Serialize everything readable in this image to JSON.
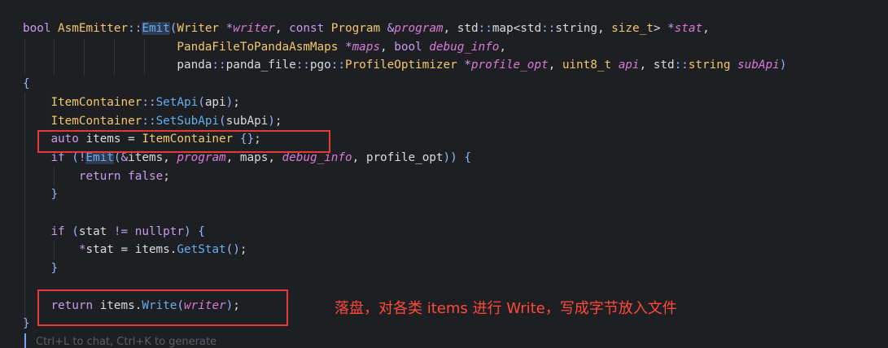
{
  "editor": {
    "lines": [
      [
        [
          "kw",
          "bool "
        ],
        [
          "type",
          "AsmEmitter"
        ],
        [
          "punc",
          "::"
        ],
        [
          "fn hl",
          "Emit"
        ],
        [
          "punc",
          "("
        ],
        [
          "type",
          "Writer "
        ],
        [
          "op",
          "*"
        ],
        [
          "param",
          "writer"
        ],
        [
          "plain",
          ", "
        ],
        [
          "kw",
          "const "
        ],
        [
          "type",
          "Program "
        ],
        [
          "op",
          "&"
        ],
        [
          "param",
          "program"
        ],
        [
          "plain",
          ", std"
        ],
        [
          "punc",
          "::"
        ],
        [
          "plain",
          "map<std"
        ],
        [
          "punc",
          "::"
        ],
        [
          "plain",
          "string, "
        ],
        [
          "type",
          "size_t"
        ],
        [
          "plain",
          "> "
        ],
        [
          "op",
          "*"
        ],
        [
          "param",
          "stat"
        ],
        [
          "plain",
          ","
        ]
      ],
      [
        [
          "plain",
          "                      "
        ],
        [
          "type",
          "PandaFileToPandaAsmMaps "
        ],
        [
          "op",
          "*"
        ],
        [
          "param",
          "maps"
        ],
        [
          "plain",
          ", "
        ],
        [
          "kw",
          "bool "
        ],
        [
          "param",
          "debug_info"
        ],
        [
          "plain",
          ","
        ]
      ],
      [
        [
          "plain",
          "                      panda"
        ],
        [
          "punc",
          "::"
        ],
        [
          "plain",
          "panda_file"
        ],
        [
          "punc",
          "::"
        ],
        [
          "plain",
          "pgo"
        ],
        [
          "punc",
          "::"
        ],
        [
          "type",
          "ProfileOptimizer "
        ],
        [
          "op",
          "*"
        ],
        [
          "param",
          "profile_opt"
        ],
        [
          "plain",
          ", "
        ],
        [
          "type",
          "uint8_t "
        ],
        [
          "param",
          "api"
        ],
        [
          "plain",
          ", std"
        ],
        [
          "punc",
          "::"
        ],
        [
          "type",
          "string "
        ],
        [
          "param",
          "subApi"
        ],
        [
          "punc",
          ")"
        ]
      ],
      [
        [
          "punc",
          "{"
        ]
      ],
      [
        [
          "plain",
          "    "
        ],
        [
          "type",
          "ItemContainer"
        ],
        [
          "punc",
          "::"
        ],
        [
          "fn",
          "SetApi"
        ],
        [
          "punc",
          "("
        ],
        [
          "plain",
          "api"
        ],
        [
          "punc",
          ")"
        ],
        [
          "plain",
          ";"
        ]
      ],
      [
        [
          "plain",
          "    "
        ],
        [
          "type",
          "ItemContainer"
        ],
        [
          "punc",
          "::"
        ],
        [
          "fn",
          "SetSubApi"
        ],
        [
          "punc",
          "("
        ],
        [
          "plain",
          "subApi"
        ],
        [
          "punc",
          ")"
        ],
        [
          "plain",
          ";"
        ]
      ],
      [
        [
          "plain",
          "    "
        ],
        [
          "kw",
          "auto "
        ],
        [
          "plain",
          "items = "
        ],
        [
          "type",
          "ItemContainer "
        ],
        [
          "punc",
          "{}"
        ],
        [
          "plain",
          ";"
        ]
      ],
      [
        [
          "plain",
          "    "
        ],
        [
          "kw",
          "if "
        ],
        [
          "punc",
          "("
        ],
        [
          "op",
          "!"
        ],
        [
          "fn hl",
          "Emit"
        ],
        [
          "punc",
          "("
        ],
        [
          "op",
          "&"
        ],
        [
          "plain",
          "items, "
        ],
        [
          "param",
          "program"
        ],
        [
          "plain",
          ", maps, "
        ],
        [
          "param",
          "debug_info"
        ],
        [
          "plain",
          ", profile_opt"
        ],
        [
          "punc",
          "))"
        ],
        [
          "plain",
          " "
        ],
        [
          "punc",
          "{"
        ]
      ],
      [
        [
          "plain",
          "        "
        ],
        [
          "kw",
          "return "
        ],
        [
          "kw",
          "false"
        ],
        [
          "plain",
          ";"
        ]
      ],
      [
        [
          "plain",
          "    "
        ],
        [
          "punc",
          "}"
        ]
      ],
      [
        [
          "plain",
          ""
        ]
      ],
      [
        [
          "plain",
          "    "
        ],
        [
          "kw",
          "if "
        ],
        [
          "punc",
          "("
        ],
        [
          "plain",
          "stat "
        ],
        [
          "op",
          "!= "
        ],
        [
          "kw",
          "nullptr"
        ],
        [
          "punc",
          ")"
        ],
        [
          "plain",
          " "
        ],
        [
          "punc",
          "{"
        ]
      ],
      [
        [
          "plain",
          "        "
        ],
        [
          "op",
          "*"
        ],
        [
          "plain",
          "stat = items."
        ],
        [
          "fn",
          "GetStat"
        ],
        [
          "punc",
          "()"
        ],
        [
          "plain",
          ";"
        ]
      ],
      [
        [
          "plain",
          "    "
        ],
        [
          "punc",
          "}"
        ]
      ],
      [
        [
          "plain",
          ""
        ]
      ],
      [
        [
          "plain",
          "    "
        ],
        [
          "kw",
          "return "
        ],
        [
          "plain",
          "items."
        ],
        [
          "fn",
          "Write"
        ],
        [
          "punc",
          "("
        ],
        [
          "param",
          "writer"
        ],
        [
          "punc",
          ")"
        ],
        [
          "plain",
          ";"
        ]
      ],
      [
        [
          "punc",
          "}"
        ]
      ]
    ]
  },
  "annotation": {
    "text": "落盘，对各类 items 进行 Write，写成字节放入文件"
  },
  "hint": {
    "text": "Ctrl+L to chat, Ctrl+K to generate"
  }
}
